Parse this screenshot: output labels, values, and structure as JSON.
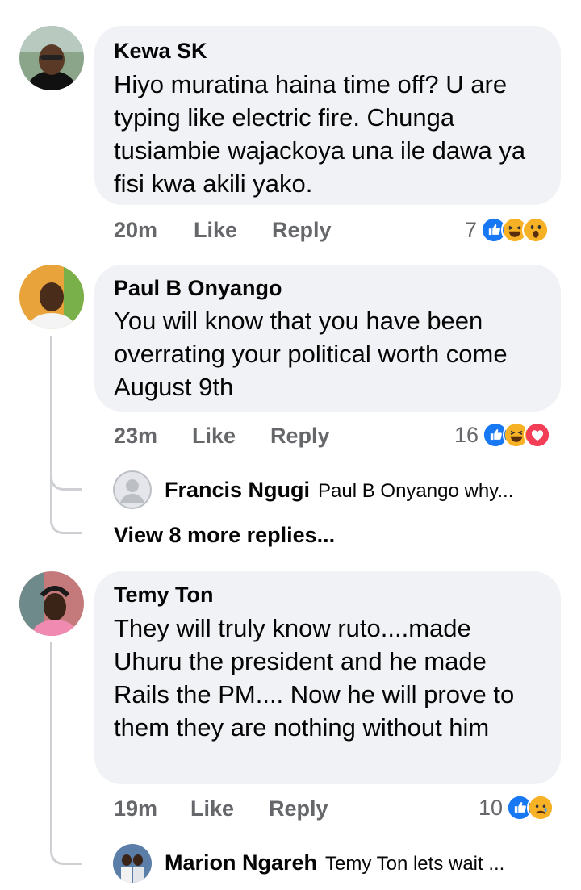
{
  "comments": [
    {
      "name": "Kewa SK",
      "text": "Hiyo muratina haina time off? U are typing like electric fire. Chunga tusiambie wajackoya una ile dawa  ya fisi kwa akili yako.",
      "time": "20m",
      "like": "Like",
      "reply": "Reply",
      "reaction_count": "7",
      "reactions": [
        "like-icon",
        "haha-icon",
        "wow-icon"
      ]
    },
    {
      "name": "Paul B Onyango",
      "text": "You will know that you have been overrating your political worth come August 9th",
      "time": "23m",
      "like": "Like",
      "reply": "Reply",
      "reaction_count": "16",
      "reactions": [
        "like-icon",
        "haha-icon",
        "love-icon"
      ],
      "replies": {
        "preview_name": "Francis Ngugi",
        "preview_text": "Paul B Onyango why...",
        "view_more": "View 8 more replies..."
      }
    },
    {
      "name": "Temy Ton",
      "text": "They will truly know ruto....made Uhuru the president and he made Rails the PM.... Now he will prove to them they are nothing without him",
      "time": "19m",
      "like": "Like",
      "reply": "Reply",
      "reaction_count": "10",
      "reactions": [
        "like-icon",
        "sad-icon"
      ],
      "replies": {
        "preview_name": "Marion Ngareh",
        "preview_text": "Temy Ton lets wait ..."
      }
    }
  ],
  "colors": {
    "bubble": "#f0f2f5",
    "meta": "#65676b",
    "like_blue": "#1877f2",
    "love_red": "#f33e58",
    "emoji_yellow": "#f7b125"
  }
}
